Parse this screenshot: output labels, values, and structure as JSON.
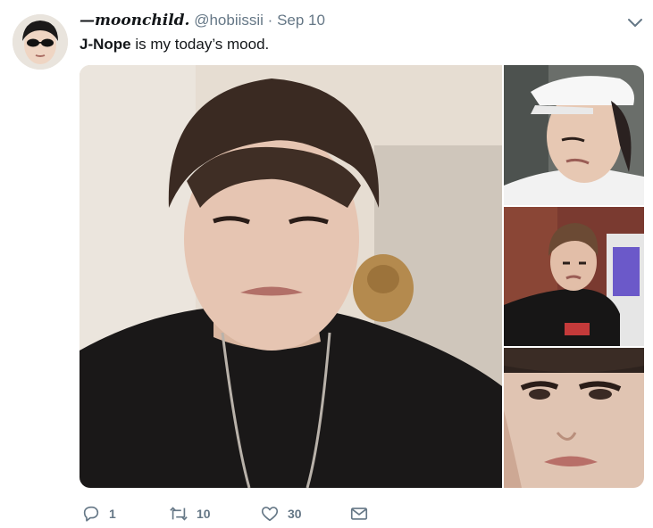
{
  "tweet": {
    "display_name": "—moonchild.",
    "handle": "@hobiissii",
    "separator": "·",
    "timestamp": "Sep 10",
    "text_bold": "J-Nope",
    "text_rest": " is my today’s mood."
  },
  "actions": {
    "reply_count": "1",
    "retweet_count": "10",
    "like_count": "30"
  },
  "icons": {
    "caret": "chevron-down-icon",
    "reply": "reply-icon",
    "retweet": "retweet-icon",
    "like": "heart-icon",
    "dm": "envelope-icon"
  },
  "colors": {
    "secondary_text": "#657786",
    "primary_text": "#14171a"
  }
}
